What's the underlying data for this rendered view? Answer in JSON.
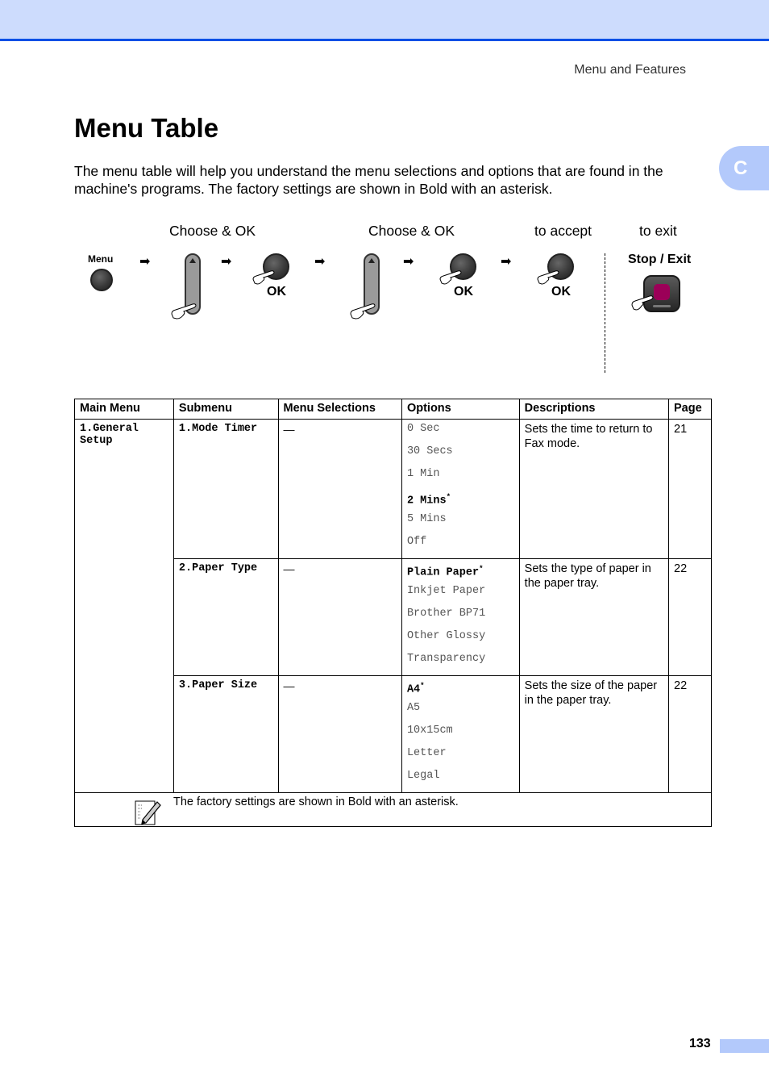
{
  "header": {
    "running_head": "Menu and Features",
    "chapter_tab": "C"
  },
  "title": "Menu Table",
  "intro": "The menu table will help you understand the menu selections and options that are found in the machine's programs. The factory settings are shown in Bold with an asterisk.",
  "flow": {
    "step_labels": [
      "Choose & OK",
      "Choose & OK",
      "to accept",
      "to exit"
    ],
    "menu_label": "Menu",
    "ok_label": "OK",
    "stop_label": "Stop / Exit",
    "arrow_glyph": "➡"
  },
  "table": {
    "headers": [
      "Main Menu",
      "Submenu",
      "Menu Selections",
      "Options",
      "Descriptions",
      "Page"
    ],
    "main_menu": "1.General Setup",
    "rows": [
      {
        "submenu": "1.Mode Timer",
        "selection": "—",
        "options": [
          {
            "label": "0 Sec",
            "default": false
          },
          {
            "label": "30 Secs",
            "default": false
          },
          {
            "label": "1 Min",
            "default": false
          },
          {
            "label": "2 Mins",
            "default": true
          },
          {
            "label": "5 Mins",
            "default": false
          },
          {
            "label": "Off",
            "default": false
          }
        ],
        "description": "Sets the time to return to Fax mode.",
        "page": "21"
      },
      {
        "submenu": "2.Paper Type",
        "selection": "—",
        "options": [
          {
            "label": "Plain Paper",
            "default": true
          },
          {
            "label": "Inkjet Paper",
            "default": false
          },
          {
            "label": "Brother BP71",
            "default": false
          },
          {
            "label": "Other Glossy",
            "default": false
          },
          {
            "label": "Transparency",
            "default": false
          }
        ],
        "description": "Sets the type of paper in the paper tray.",
        "page": "22"
      },
      {
        "submenu": "3.Paper Size",
        "selection": "—",
        "options": [
          {
            "label": "A4",
            "default": true
          },
          {
            "label": "A5",
            "default": false
          },
          {
            "label": "10x15cm",
            "default": false
          },
          {
            "label": "Letter",
            "default": false
          },
          {
            "label": "Legal",
            "default": false
          }
        ],
        "description": "Sets the size of the paper in the paper tray.",
        "page": "22"
      }
    ],
    "note": "The factory settings are shown in Bold with an asterisk.",
    "asterisk": "*"
  },
  "footer": {
    "page_number": "133"
  },
  "colors": {
    "band": "#cddcfd",
    "band_rule": "#0050e6",
    "tab": "#b3c9fb",
    "stop_key": "#9b0058"
  }
}
